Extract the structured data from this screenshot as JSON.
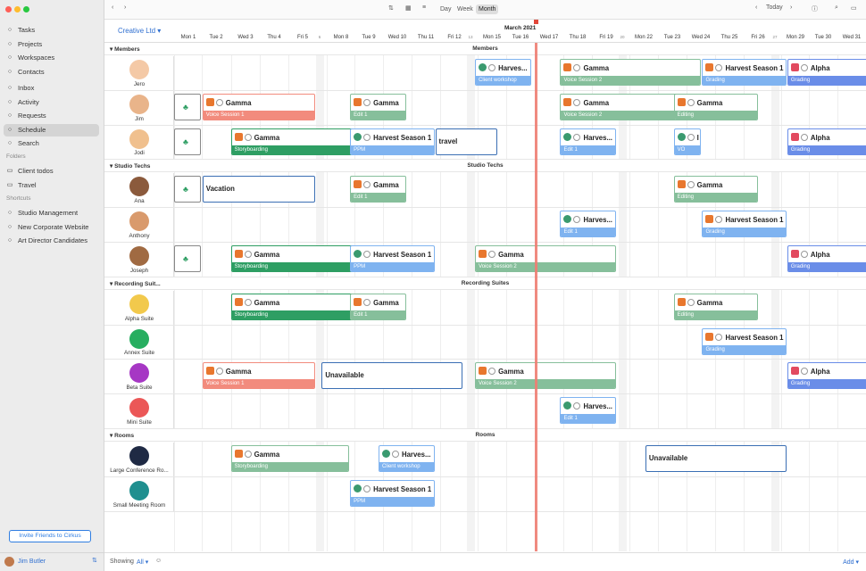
{
  "window": {
    "title": "Creative Ltd"
  },
  "sidebar": {
    "nav": [
      {
        "label": "Tasks",
        "icon": "circle-icon"
      },
      {
        "label": "Projects",
        "icon": "projects-icon"
      },
      {
        "label": "Workspaces",
        "icon": "workspaces-icon"
      },
      {
        "label": "Contacts",
        "icon": "contacts-icon"
      }
    ],
    "nav2": [
      {
        "label": "Inbox",
        "icon": "inbox-icon"
      },
      {
        "label": "Activity",
        "icon": "activity-icon"
      },
      {
        "label": "Requests",
        "icon": "requests-icon"
      },
      {
        "label": "Schedule",
        "icon": "calendar-icon",
        "selected": true
      },
      {
        "label": "Search",
        "icon": "search-icon"
      }
    ],
    "folders_header": "Folders",
    "folders": [
      {
        "label": "Client todos"
      },
      {
        "label": "Travel"
      }
    ],
    "shortcuts_header": "Shortcuts",
    "shortcuts": [
      {
        "label": "Studio Management"
      },
      {
        "label": "New Corporate Website"
      },
      {
        "label": "Art Director Candidates"
      }
    ],
    "invite_label": "Invite Friends to Cirkus",
    "user_name": "Jim Butler"
  },
  "toolbar": {
    "views": [
      "Day",
      "Week",
      "Month"
    ],
    "selected_view": "Month",
    "today_label": "Today"
  },
  "calendar": {
    "month_label": "March 2021",
    "days": [
      "Mon 1",
      "Tue 2",
      "Wed 3",
      "Thu 4",
      "Fri 5",
      "Sat 6",
      "Mon 8",
      "Tue 9",
      "Wed 10",
      "Thu 11",
      "Fri 12",
      "Sat 13",
      "Mon 15",
      "Tue 16",
      "Wed 17",
      "Thu 18",
      "Fri 19",
      "Sat 20",
      "Mon 22",
      "Tue 23",
      "Wed 24",
      "Thu 25",
      "Fri 26",
      "Sat 27",
      "Mon 29",
      "Tue 30",
      "Wed 31"
    ],
    "small_days": [
      "6",
      "13",
      "20",
      "27"
    ]
  },
  "groups": [
    {
      "name": "Members",
      "rows": [
        {
          "name": "Jero",
          "color": "#f4c9a6"
        },
        {
          "name": "Jim",
          "color": "#e9b48a"
        },
        {
          "name": "Jodi",
          "color": "#f0c08e"
        }
      ]
    },
    {
      "name": "Studio Techs",
      "rows": [
        {
          "name": "Ana",
          "color": "#8b5a3c"
        },
        {
          "name": "Anthony",
          "color": "#d99a6c"
        },
        {
          "name": "Joseph",
          "color": "#a06a42"
        }
      ]
    },
    {
      "name": "Recording Suites",
      "short": "Recording Suit...",
      "rows": [
        {
          "name": "Alpha Suite",
          "color": "#f2c94c"
        },
        {
          "name": "Annex Suite",
          "color": "#27ae60"
        },
        {
          "name": "Beta Suite",
          "color": "#a637c4"
        },
        {
          "name": "Mini Suite",
          "color": "#eb5757"
        }
      ]
    },
    {
      "name": "Rooms",
      "rows": [
        {
          "name": "Large Conference Ro...",
          "color": "#1f2a44"
        },
        {
          "name": "Small Meeting Room",
          "color": "#1f8f8f"
        }
      ]
    }
  ],
  "events": [
    {
      "row": 0,
      "title": "Harves...",
      "bar": "Client workshop",
      "barColor": "#7fb3f0",
      "icon": "b"
    },
    {
      "row": 0,
      "title": "Gamma",
      "bar": "Voice Session 2",
      "barColor": "#86bf9b",
      "icon": ""
    },
    {
      "row": 0,
      "title": "Harvest Season 1",
      "bar": "Grading",
      "barColor": "#7fb3f0",
      "icon": ""
    },
    {
      "row": 0,
      "title": "Alpha",
      "bar": "Grading",
      "barColor": "#6a8de8",
      "icon": "r"
    },
    {
      "row": 1,
      "title": "Gamma",
      "bar": "Voice Session 1",
      "barColor": "#f28b7d",
      "icon": ""
    },
    {
      "row": 1,
      "title": "Gamma",
      "bar": "Edit 1",
      "barColor": "#86bf9b",
      "icon": ""
    },
    {
      "row": 1,
      "title": "Gamma",
      "bar": "Voice Session 2",
      "barColor": "#86bf9b",
      "icon": ""
    },
    {
      "row": 1,
      "title": "Gamma",
      "bar": "Editing",
      "barColor": "#86bf9b",
      "icon": ""
    },
    {
      "row": 2,
      "title": "Gamma",
      "bar": "Storyboarding",
      "barColor": "#2e9e63",
      "icon": ""
    },
    {
      "row": 2,
      "title": "Harvest Season 1",
      "bar": "PPM",
      "barColor": "#7fb3f0",
      "icon": "b"
    },
    {
      "row": 2,
      "title": "travel",
      "bar": "",
      "barColor": "",
      "icon": "none"
    },
    {
      "row": 2,
      "title": "Harves...",
      "bar": "Edit 1",
      "barColor": "#7fb3f0",
      "icon": "b"
    },
    {
      "row": 2,
      "title": "I",
      "bar": "VO",
      "barColor": "#7fb3f0",
      "icon": "b"
    },
    {
      "row": 2,
      "title": "Alpha",
      "bar": "Grading",
      "barColor": "#6a8de8",
      "icon": "r"
    },
    {
      "row": 3,
      "title": "Vacation",
      "bar": "",
      "barColor": "",
      "icon": "none"
    },
    {
      "row": 3,
      "title": "Gamma",
      "bar": "Edit 1",
      "barColor": "#86bf9b",
      "icon": ""
    },
    {
      "row": 3,
      "title": "Gamma",
      "bar": "Editing",
      "barColor": "#86bf9b",
      "icon": ""
    },
    {
      "row": 4,
      "title": "Harves...",
      "bar": "Edit 1",
      "barColor": "#7fb3f0",
      "icon": "b"
    },
    {
      "row": 4,
      "title": "Harvest Season 1",
      "bar": "Grading",
      "barColor": "#7fb3f0",
      "icon": ""
    },
    {
      "row": 5,
      "title": "Gamma",
      "bar": "Storyboarding",
      "barColor": "#2e9e63",
      "icon": ""
    },
    {
      "row": 5,
      "title": "Harvest Season 1",
      "bar": "PPM",
      "barColor": "#7fb3f0",
      "icon": "b"
    },
    {
      "row": 5,
      "title": "Gamma",
      "bar": "Voice Session 2",
      "barColor": "#86bf9b",
      "icon": ""
    },
    {
      "row": 5,
      "title": "Alpha",
      "bar": "Grading",
      "barColor": "#6a8de8",
      "icon": "r"
    },
    {
      "row": 6,
      "title": "Gamma",
      "bar": "Storyboarding",
      "barColor": "#2e9e63",
      "icon": ""
    },
    {
      "row": 6,
      "title": "Gamma",
      "bar": "Edit 1",
      "barColor": "#86bf9b",
      "icon": ""
    },
    {
      "row": 6,
      "title": "Gamma",
      "bar": "Editing",
      "barColor": "#86bf9b",
      "icon": ""
    },
    {
      "row": 7,
      "title": "Harvest Season 1",
      "bar": "Grading",
      "barColor": "#7fb3f0",
      "icon": ""
    },
    {
      "row": 8,
      "title": "Gamma",
      "bar": "Voice Session 1",
      "barColor": "#f28b7d",
      "icon": ""
    },
    {
      "row": 8,
      "title": "Unavailable",
      "bar": "",
      "barColor": "",
      "icon": "none"
    },
    {
      "row": 8,
      "title": "Gamma",
      "bar": "Voice Session 2",
      "barColor": "#86bf9b",
      "icon": ""
    },
    {
      "row": 8,
      "title": "Alpha",
      "bar": "Grading",
      "barColor": "#6a8de8",
      "icon": "r"
    },
    {
      "row": 9,
      "title": "Harves...",
      "bar": "Edit 1",
      "barColor": "#7fb3f0",
      "icon": "b"
    },
    {
      "row": 10,
      "title": "Gamma",
      "bar": "Storyboarding",
      "barColor": "#86bf9b",
      "icon": ""
    },
    {
      "row": 10,
      "title": "Harves...",
      "bar": "Client workshop",
      "barColor": "#7fb3f0",
      "icon": "b"
    },
    {
      "row": 10,
      "title": "Unavailable",
      "bar": "",
      "barColor": "",
      "icon": "none"
    },
    {
      "row": 11,
      "title": "Harvest Season 1",
      "bar": "PPM",
      "barColor": "#7fb3f0",
      "icon": "b"
    }
  ],
  "footer": {
    "showing_label": "Showing",
    "showing_value": "All",
    "add_label": "Add"
  }
}
